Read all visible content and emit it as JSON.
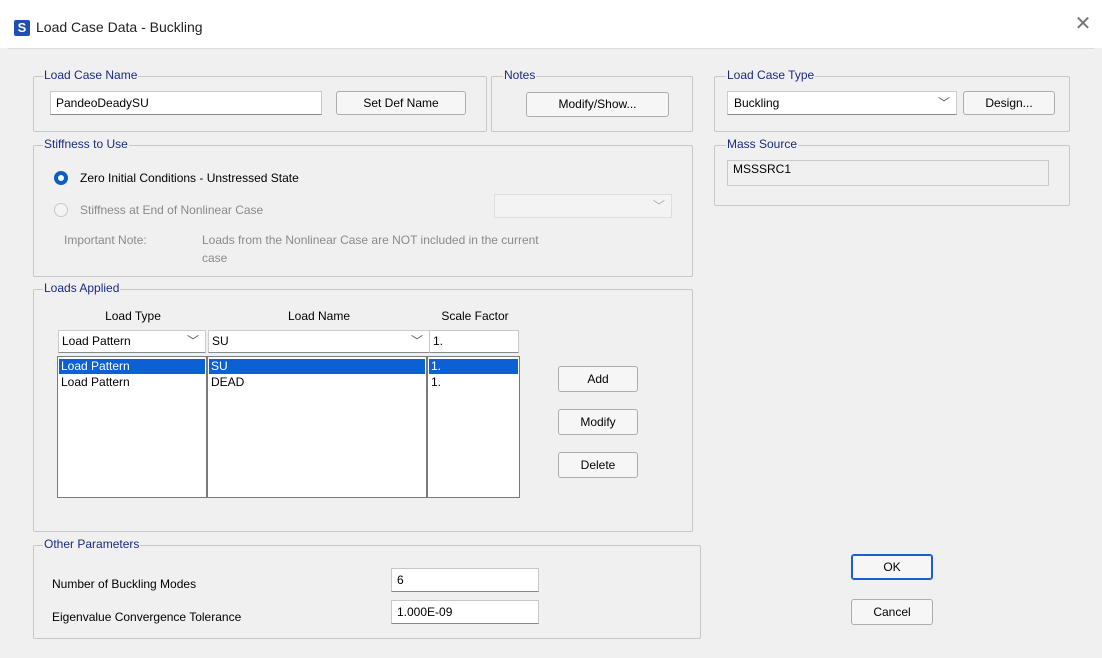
{
  "window": {
    "title": "Load Case Data - Buckling",
    "app_icon_letter": "S",
    "close_glyph": "✕"
  },
  "load_case_name": {
    "group_title": "Load Case Name",
    "value": "PandeoDeadySU",
    "set_def_button": "Set Def Name"
  },
  "notes": {
    "group_title": "Notes",
    "button": "Modify/Show..."
  },
  "load_case_type": {
    "group_title": "Load Case Type",
    "selected": "Buckling",
    "design_button": "Design..."
  },
  "mass_source": {
    "group_title": "Mass Source",
    "value": "MSSSRC1"
  },
  "stiffness": {
    "group_title": "Stiffness to Use",
    "option_zero": "Zero Initial Conditions - Unstressed State",
    "option_nonlinear": "Stiffness at End of Nonlinear Case",
    "note_label": "Important Note:",
    "note_text_line1": "Loads from the Nonlinear Case are NOT included in the current",
    "note_text_line2": "case"
  },
  "loads_applied": {
    "group_title": "Loads Applied",
    "headers": {
      "load_type": "Load Type",
      "load_name": "Load Name",
      "scale_factor": "Scale Factor"
    },
    "entry": {
      "load_type": "Load Pattern",
      "load_name": "SU",
      "scale_factor": "1."
    },
    "rows": [
      {
        "load_type": "Load Pattern",
        "load_name": "SU",
        "scale_factor": "1."
      },
      {
        "load_type": "Load Pattern",
        "load_name": "DEAD",
        "scale_factor": "1."
      }
    ],
    "buttons": {
      "add": "Add",
      "modify": "Modify",
      "delete": "Delete"
    }
  },
  "other_parameters": {
    "group_title": "Other Parameters",
    "buckling_modes_label": "Number of Buckling Modes",
    "buckling_modes_value": "6",
    "tolerance_label": "Eigenvalue Convergence Tolerance",
    "tolerance_value": "1.000E-09"
  },
  "actions": {
    "ok": "OK",
    "cancel": "Cancel"
  },
  "chevron_glyph": "﹀"
}
